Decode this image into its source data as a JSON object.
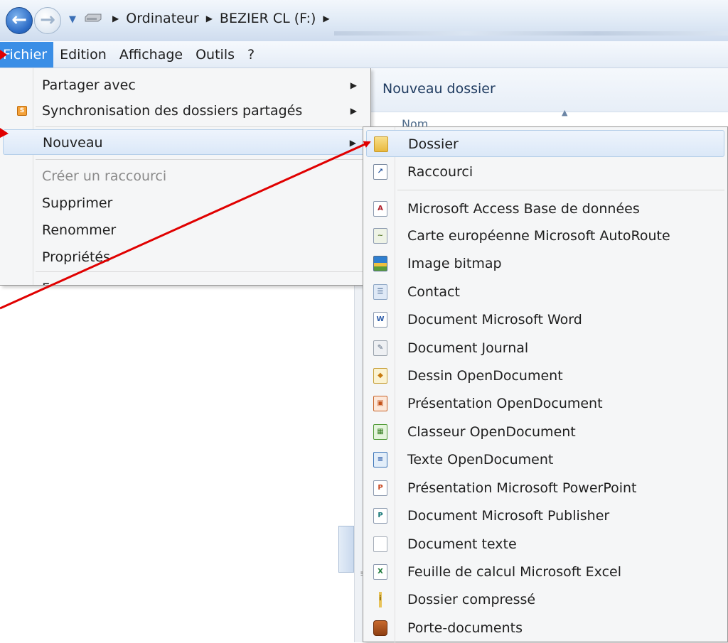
{
  "address_bar": {
    "breadcrumb": [
      "Ordinateur",
      "BEZIER CL (F:)"
    ],
    "separator_glyph": "▶"
  },
  "menubar": {
    "items": [
      "Fichier",
      "Edition",
      "Affichage",
      "Outils",
      "?"
    ],
    "active_item": "Fichier"
  },
  "content": {
    "header_label": "Nouveau dossier",
    "column_name": "Nom"
  },
  "file_menu": {
    "items": [
      {
        "label": "Partager avec",
        "has_submenu": true,
        "enabled": true
      },
      {
        "label": "Synchronisation des dossiers partagés",
        "has_submenu": true,
        "enabled": true,
        "icon": "sync-icon"
      },
      {
        "label": "Nouveau",
        "has_submenu": true,
        "enabled": true,
        "highlighted": true
      },
      {
        "label": "Créer un raccourci",
        "enabled": false
      },
      {
        "label": "Supprimer",
        "enabled": true
      },
      {
        "label": "Renommer",
        "enabled": true
      },
      {
        "label": "Propriétés",
        "enabled": true
      },
      {
        "label": "Fermer",
        "enabled": true
      }
    ]
  },
  "new_submenu": {
    "items": [
      {
        "label": "Dossier",
        "icon": "folder-icon",
        "highlighted": true
      },
      {
        "label": "Raccourci",
        "icon": "shortcut-icon"
      },
      {
        "label": "Microsoft Access Base de données",
        "icon": "access-icon"
      },
      {
        "label": "Carte européenne Microsoft AutoRoute",
        "icon": "autoroute-icon"
      },
      {
        "label": "Image bitmap",
        "icon": "bitmap-icon"
      },
      {
        "label": "Contact",
        "icon": "contact-icon"
      },
      {
        "label": "Document Microsoft Word",
        "icon": "word-icon"
      },
      {
        "label": "Document Journal",
        "icon": "journal-icon"
      },
      {
        "label": "Dessin OpenDocument",
        "icon": "odg-icon"
      },
      {
        "label": "Présentation OpenDocument",
        "icon": "odp-icon"
      },
      {
        "label": "Classeur OpenDocument",
        "icon": "ods-icon"
      },
      {
        "label": "Texte OpenDocument",
        "icon": "odt-icon"
      },
      {
        "label": "Présentation Microsoft PowerPoint",
        "icon": "powerpoint-icon"
      },
      {
        "label": "Document Microsoft Publisher",
        "icon": "publisher-icon"
      },
      {
        "label": "Document texte",
        "icon": "text-document-icon"
      },
      {
        "label": "Feuille de calcul Microsoft Excel",
        "icon": "excel-icon"
      },
      {
        "label": "Dossier compressé",
        "icon": "zip-folder-icon"
      },
      {
        "label": "Porte-documents",
        "icon": "briefcase-icon"
      }
    ]
  },
  "colors": {
    "menu_active": "#3a8ee6",
    "annotation_arrow": "#e00000",
    "hover_border": "#b5cfe9"
  }
}
